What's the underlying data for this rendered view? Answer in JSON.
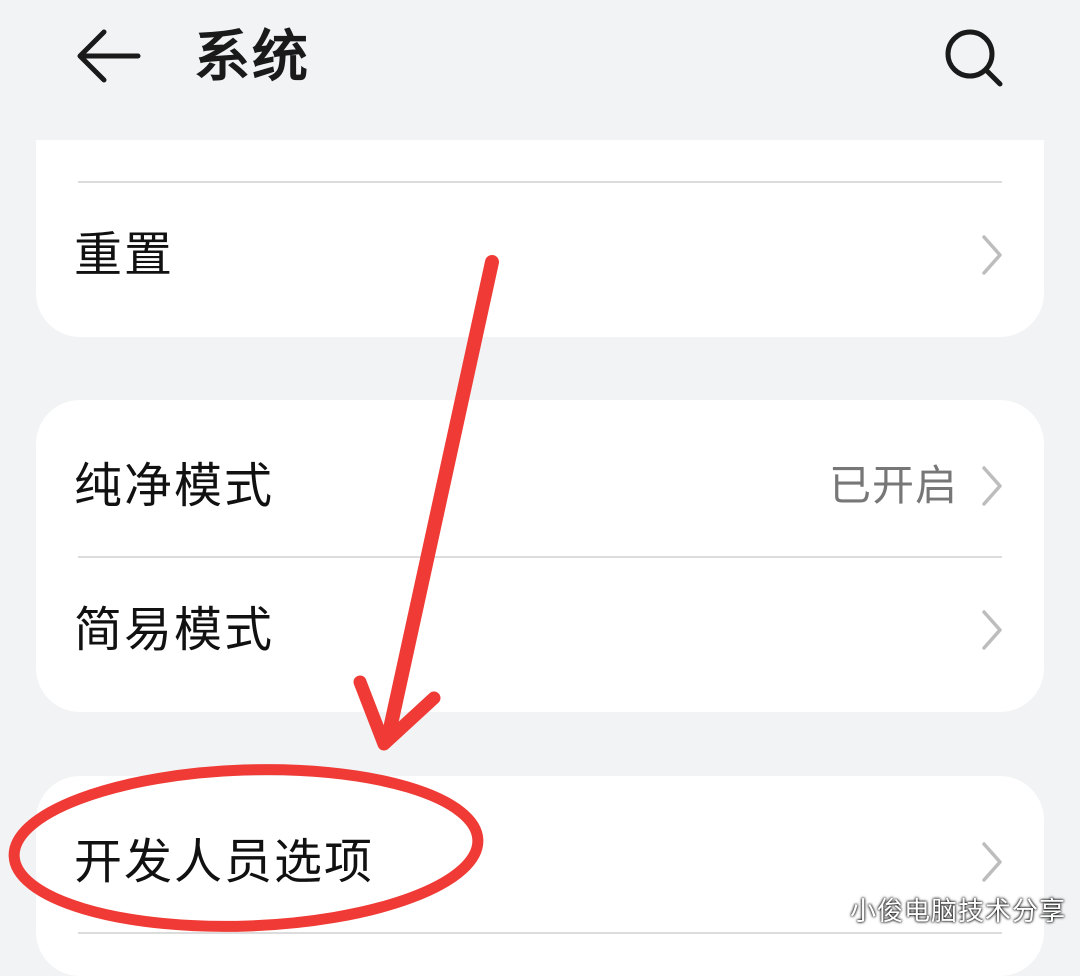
{
  "header": {
    "title": "系统",
    "back_icon": "arrow-left-icon",
    "search_icon": "search-icon"
  },
  "groups": [
    {
      "items": [
        {
          "label": "重置",
          "value": ""
        }
      ]
    },
    {
      "items": [
        {
          "label": "纯净模式",
          "value": "已开启"
        },
        {
          "label": "简易模式",
          "value": ""
        }
      ]
    },
    {
      "items": [
        {
          "label": "开发人员选项",
          "value": ""
        }
      ]
    }
  ],
  "annotation": {
    "color": "#f03a35"
  },
  "watermark": "小俊电脑技术分享"
}
